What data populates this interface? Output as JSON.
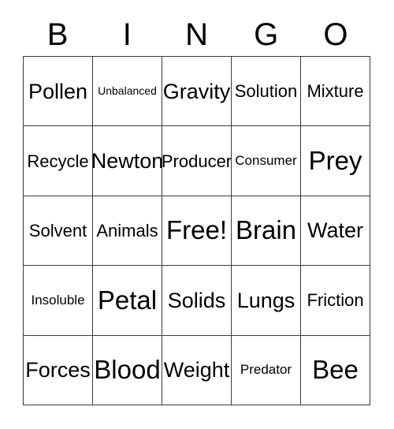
{
  "card": {
    "title_letters": [
      "B",
      "I",
      "N",
      "G",
      "O"
    ],
    "colors": {
      "background": "#ffffff",
      "text": "#000000",
      "grid_line": "#3a3a3a"
    },
    "grid": {
      "columns": 5,
      "rows": 5,
      "cells": [
        {
          "text": "Pollen",
          "size": "fs-l"
        },
        {
          "text": "Unbalanced",
          "size": "fs-xs"
        },
        {
          "text": "Gravity",
          "size": "fs-l"
        },
        {
          "text": "Solution",
          "size": "fs-m"
        },
        {
          "text": "Mixture",
          "size": "fs-m"
        },
        {
          "text": "Recycle",
          "size": "fs-m"
        },
        {
          "text": "Newton",
          "size": "fs-l"
        },
        {
          "text": "Producer",
          "size": "fs-m"
        },
        {
          "text": "Consumer",
          "size": "fs-s"
        },
        {
          "text": "Prey",
          "size": "fs-xl"
        },
        {
          "text": "Solvent",
          "size": "fs-m"
        },
        {
          "text": "Animals",
          "size": "fs-m"
        },
        {
          "text": "Free!",
          "size": "fs-xl"
        },
        {
          "text": "Brain",
          "size": "fs-xl"
        },
        {
          "text": "Water",
          "size": "fs-l"
        },
        {
          "text": "Insoluble",
          "size": "fs-s"
        },
        {
          "text": "Petal",
          "size": "fs-xl"
        },
        {
          "text": "Solids",
          "size": "fs-l"
        },
        {
          "text": "Lungs",
          "size": "fs-l"
        },
        {
          "text": "Friction",
          "size": "fs-m"
        },
        {
          "text": "Forces",
          "size": "fs-l"
        },
        {
          "text": "Blood",
          "size": "fs-xl"
        },
        {
          "text": "Weight",
          "size": "fs-l"
        },
        {
          "text": "Predator",
          "size": "fs-s"
        },
        {
          "text": "Bee",
          "size": "fs-xl"
        }
      ]
    }
  }
}
